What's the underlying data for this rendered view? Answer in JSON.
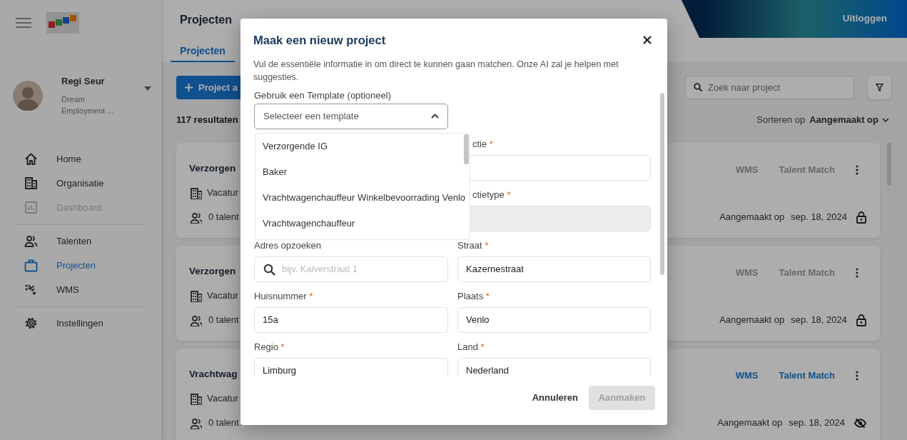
{
  "sidebar": {
    "user": {
      "name": "Regi Seur",
      "company": "Dream Employment ..."
    },
    "nav_groups": [
      {
        "items": [
          {
            "label": "Home",
            "selected": false,
            "disabled": false
          },
          {
            "label": "Organisatie",
            "selected": false,
            "disabled": false
          },
          {
            "label": "Dashboard",
            "selected": false,
            "disabled": true
          }
        ]
      },
      {
        "items": [
          {
            "label": "Talenten",
            "selected": false,
            "disabled": false
          },
          {
            "label": "Projecten",
            "selected": true,
            "disabled": false
          },
          {
            "label": "WMS",
            "selected": false,
            "disabled": false
          }
        ]
      },
      {
        "items": [
          {
            "label": "Instellingen",
            "selected": false,
            "disabled": false
          }
        ]
      }
    ]
  },
  "header": {
    "title": "Projecten",
    "tabs": [
      {
        "label": "Projecten",
        "selected": true
      }
    ],
    "logout": "Uitloggen"
  },
  "toolbar": {
    "add_button": "Project a",
    "results": "117 resultaten",
    "search": {
      "placeholder": "Zoek naar project"
    },
    "sort_label": "Sorteren op",
    "sort_value": "Aangemaakt op"
  },
  "projects": [
    {
      "title": "Verzorgen",
      "type": "Vacatur",
      "talents": "0 talent",
      "actions": [
        "WMS",
        "Talent Match"
      ],
      "actions_enabled": false,
      "created_label": "Aangemaakt op",
      "created_date": "sep. 18, 2024",
      "kind": "locked"
    },
    {
      "title": "Verzorgen",
      "type": "Vacatur",
      "talents": "0 talent",
      "actions": [
        "WMS",
        "Talent Match"
      ],
      "actions_enabled": false,
      "created_label": "Aangemaakt op",
      "created_date": "sep. 18, 2024",
      "kind": "locked"
    },
    {
      "title": "Vrachtwag",
      "type": "Vacatur",
      "talents": "0 talent",
      "actions": [
        "WMS",
        "Talent Match"
      ],
      "actions_enabled": true,
      "created_label": "Aangemaakt op",
      "created_date": "sep. 18, 2024",
      "kind": "hidden"
    }
  ],
  "modal": {
    "title": "Maak een nieuw project",
    "description": "Vul de essentiële informatie in om direct te kunnen gaan matchen. Onze AI zal je helpen met suggesties.",
    "template": {
      "label": "Gebruik een Template (optioneel)",
      "placeholder": "Selecteer een template",
      "expanded": true,
      "options": [
        {
          "label": "Verzorgende IG"
        },
        {
          "label": "Baker"
        },
        {
          "label": "Vrachtwagenchauffeur Winkelbevoorrading Venlo"
        },
        {
          "label": "Vrachtwagenchauffeur"
        }
      ]
    },
    "fields": [
      {
        "kind": "text",
        "label": "ctie",
        "required_mark": "*",
        "covered": true,
        "disabled": false
      },
      {
        "kind": "text",
        "label": "ctietype",
        "required_mark": "*",
        "covered": true,
        "disabled": true
      },
      {
        "kind": "search",
        "label": "Adres opzoeken",
        "placeholder": "bijv. Kalverstraat 1",
        "covered": false,
        "disabled": false
      },
      {
        "kind": "text",
        "label": "Straat",
        "required_mark": "*",
        "value": "Kazernestraat",
        "covered": false,
        "disabled": false
      },
      {
        "kind": "text",
        "label": "Huisnummer",
        "required_mark": "*",
        "value": "15a",
        "covered": false,
        "disabled": false
      },
      {
        "kind": "text",
        "label": "Plaats",
        "required_mark": "*",
        "value": "Venlo",
        "covered": false,
        "disabled": false
      },
      {
        "kind": "text",
        "label": "Regio",
        "required_mark": "*",
        "value": "Limburg",
        "covered": false,
        "disabled": false
      },
      {
        "kind": "text",
        "label": "Land",
        "required_mark": "*",
        "value": "Nederland",
        "covered": false,
        "disabled": false
      }
    ],
    "buttons": {
      "cancel": "Annuleren",
      "create": "Aanmaken",
      "create_disabled": true
    }
  }
}
